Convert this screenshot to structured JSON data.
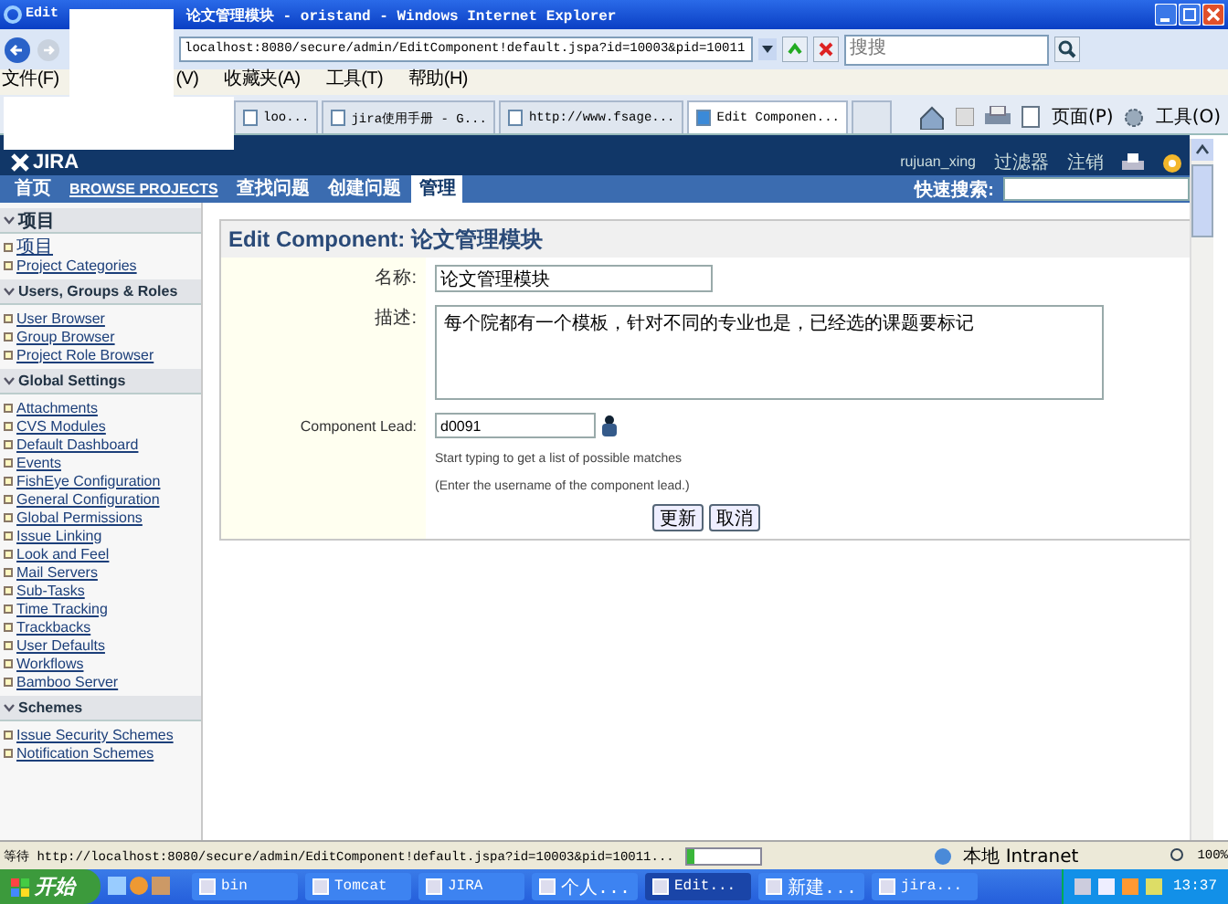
{
  "window": {
    "title_start": "Edit",
    "title_end": "论文管理模块 - oristand - Windows Internet Explorer"
  },
  "address_bar": {
    "value": "localhost:8080/secure/admin/EditComponent!default.jspa?id=10003&pid=10011"
  },
  "search_box": {
    "placeholder": "搜搜"
  },
  "menu": [
    "文件(F)",
    "(V)",
    "收藏夹(A)",
    "工具(T)",
    "帮助(H)"
  ],
  "tabs": [
    {
      "label": "loo...",
      "selected": false
    },
    {
      "label": "jira使用手册 - G...",
      "selected": false
    },
    {
      "label": "http://www.fsage...",
      "selected": false
    },
    {
      "label": "Edit Componen...",
      "selected": true
    }
  ],
  "command_bar": [
    "页面(P)",
    "工具(O)"
  ],
  "jira_header": {
    "logo": "JIRA",
    "user": "rujuan_xing",
    "filters": "过滤器",
    "logout": "注销"
  },
  "nav": [
    {
      "label": "首页",
      "selected": false
    },
    {
      "label": "BROWSE PROJECTS",
      "selected": false
    },
    {
      "label": "查找问题",
      "selected": false
    },
    {
      "label": "创建问题",
      "selected": false
    },
    {
      "label": "管理",
      "selected": true
    }
  ],
  "quick_search": {
    "label": "快速搜索:"
  },
  "sidebar": [
    {
      "title": "项目",
      "items": [
        "项目",
        "Project Categories"
      ]
    },
    {
      "title": "Users, Groups & Roles",
      "items": [
        "User Browser",
        "Group Browser",
        "Project Role Browser"
      ]
    },
    {
      "title": "Global Settings",
      "items": [
        "Attachments",
        "CVS Modules",
        "Default Dashboard",
        "Events",
        "FishEye Configuration",
        "General Configuration",
        "Global Permissions",
        "Issue Linking",
        "Look and Feel",
        "Mail Servers",
        "Sub-Tasks",
        "Time Tracking",
        "Trackbacks",
        "User Defaults",
        "Workflows",
        "Bamboo Server"
      ]
    },
    {
      "title": "Schemes",
      "items": [
        "Issue Security Schemes",
        "Notification Schemes"
      ]
    }
  ],
  "form": {
    "heading": "Edit Component: 论文管理模块",
    "fields": [
      {
        "kind": "text",
        "label": "名称:",
        "value": "论文管理模块"
      },
      {
        "kind": "textarea",
        "label": "描述:",
        "value": "每个院都有一个模板，针对不同的专业也是，已经选的课题要标记"
      },
      {
        "kind": "user",
        "label": "Component Lead:",
        "value": "d0091",
        "hints": [
          "Start typing to get a list of possible matches",
          "(Enter the username of the component lead.)"
        ]
      }
    ],
    "buttons": [
      "更新",
      "取消"
    ]
  },
  "status_bar": {
    "text": "等待 http://localhost:8080/secure/admin/EditComponent!default.jspa?id=10003&pid=10011...",
    "level": 0.1,
    "zone": "本地 Intranet",
    "zoom": "100%"
  },
  "taskbar": {
    "start": "开始",
    "items": [
      {
        "label": "bin",
        "selected": false
      },
      {
        "label": "Tomcat",
        "selected": false
      },
      {
        "label": "JIRA",
        "selected": false
      },
      {
        "label": "个人...",
        "selected": false
      },
      {
        "label": "Edit...",
        "selected": true
      },
      {
        "label": "新建...",
        "selected": false
      },
      {
        "label": "jira...",
        "selected": false
      }
    ],
    "clock": "13:37"
  }
}
